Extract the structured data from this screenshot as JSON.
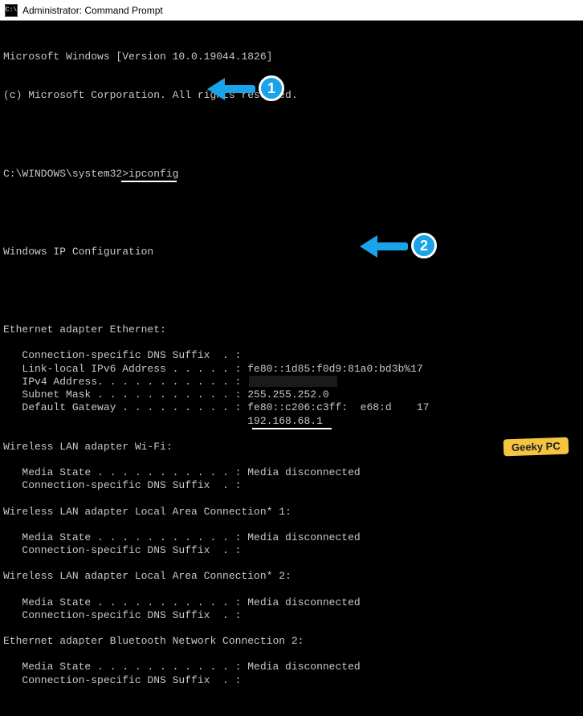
{
  "window": {
    "title": "Administrator: Command Prompt"
  },
  "version_line": "Microsoft Windows [Version 10.0.19044.1826]",
  "copyright_line": "(c) Microsoft Corporation. All rights reserved.",
  "prompt": "C:\\WINDOWS\\system32>",
  "command": "ipconfig",
  "heading": "Windows IP Configuration",
  "adapters": [
    {
      "title": "Ethernet adapter Ethernet:",
      "rows": [
        {
          "label": "Connection-specific DNS Suffix  . :",
          "value": ""
        },
        {
          "label": "Link-local IPv6 Address . . . . . :",
          "value": "fe80::1d85:f0d9:81a0:bd3b%17"
        },
        {
          "label": "IPv4 Address. . . . . . . . . . . :",
          "value": "",
          "redacted": true
        },
        {
          "label": "Subnet Mask . . . . . . . . . . . :",
          "value": "255.255.252.0"
        },
        {
          "label": "Default Gateway . . . . . . . . . :",
          "value": "fe80::c206:c3ff:  e68:d    17"
        },
        {
          "continuation": true,
          "value": "192.168.68.1",
          "highlight": true
        }
      ]
    },
    {
      "title": "Wireless LAN adapter Wi-Fi:",
      "rows": [
        {
          "label": "Media State . . . . . . . . . . . :",
          "value": "Media disconnected"
        },
        {
          "label": "Connection-specific DNS Suffix  . :",
          "value": ""
        }
      ]
    },
    {
      "title": "Wireless LAN adapter Local Area Connection* 1:",
      "rows": [
        {
          "label": "Media State . . . . . . . . . . . :",
          "value": "Media disconnected"
        },
        {
          "label": "Connection-specific DNS Suffix  . :",
          "value": ""
        }
      ]
    },
    {
      "title": "Wireless LAN adapter Local Area Connection* 2:",
      "rows": [
        {
          "label": "Media State . . . . . . . . . . . :",
          "value": "Media disconnected"
        },
        {
          "label": "Connection-specific DNS Suffix  . :",
          "value": ""
        }
      ]
    },
    {
      "title": "Ethernet adapter Bluetooth Network Connection 2:",
      "rows": [
        {
          "label": "Media State . . . . . . . . . . . :",
          "value": "Media disconnected"
        },
        {
          "label": "Connection-specific DNS Suffix  . :",
          "value": ""
        }
      ]
    }
  ],
  "callouts": {
    "one": "1",
    "two": "2"
  },
  "watermark": "Geeky PC"
}
